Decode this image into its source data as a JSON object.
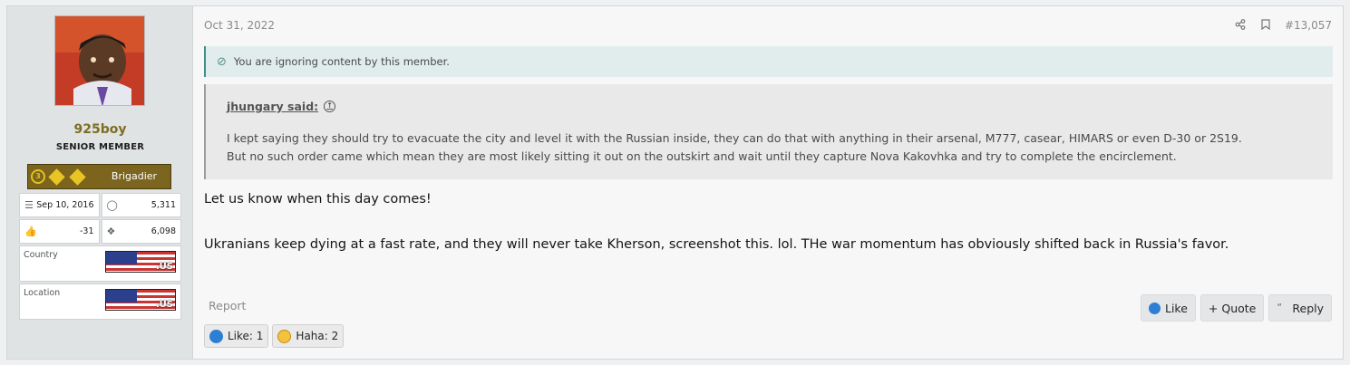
{
  "user": {
    "name": "925boy",
    "title": "SENIOR MEMBER",
    "rank": "Brigadier",
    "joined": "Sep 10, 2016",
    "messages": "5,311",
    "reaction_score": "-31",
    "points": "6,098",
    "country_label": "Country",
    "location_label": "Location",
    "flag_code": ".US"
  },
  "post": {
    "date": "Oct 31, 2022",
    "number": "#13,057",
    "ignore_notice": "You are ignoring content by this member.",
    "quote_author": "jhungary said:",
    "quote_line1": "I kept saying they should try to evacuate the city and level it with the Russian inside, they can do that with anything in their arsenal, M777, casear, HIMARS or even D-30 or 2S19.",
    "quote_line2": "But no such order came which mean they are most likely sitting it out on the outskirt and wait until they capture Nova Kakovhka and try to complete the encirclement.",
    "body_line1": "Let us know when this day comes!",
    "body_line2": "Ukranians keep dying at a fast rate, and they will never take Kherson, screenshot this. lol. THe war momentum has obviously shifted back in Russia's favor."
  },
  "actions": {
    "report": "Report",
    "like": "Like",
    "quote": "+ Quote",
    "reply": "Reply"
  },
  "reactions": {
    "like": "Like: 1",
    "haha": "Haha: 2"
  },
  "colors": {
    "username": "#7e6d22",
    "ignore_accent": "#3f8d8b",
    "like_blue": "#2d7fd3"
  }
}
